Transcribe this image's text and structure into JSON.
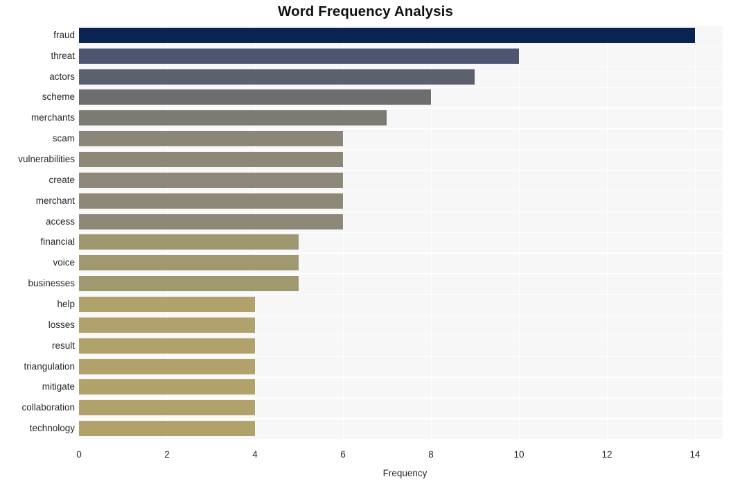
{
  "chart_data": {
    "type": "bar",
    "orientation": "horizontal",
    "title": "Word Frequency Analysis",
    "xlabel": "Frequency",
    "ylabel": "",
    "categories": [
      "fraud",
      "threat",
      "actors",
      "scheme",
      "merchants",
      "scam",
      "vulnerabilities",
      "create",
      "merchant",
      "access",
      "financial",
      "voice",
      "businesses",
      "help",
      "losses",
      "result",
      "triangulation",
      "mitigate",
      "collaboration",
      "technology"
    ],
    "values": [
      14,
      10,
      9,
      8,
      7,
      6,
      6,
      6,
      6,
      6,
      5,
      5,
      5,
      4,
      4,
      4,
      4,
      4,
      4,
      4
    ],
    "bar_colors": [
      "#0a2350",
      "#4d5570",
      "#5c616e",
      "#6b6d6e",
      "#7c7b73",
      "#8a8678",
      "#8c8878",
      "#8d8878",
      "#8d8878",
      "#8d8878",
      "#9f9770",
      "#a0986f",
      "#a0986f",
      "#b0a26a",
      "#b0a26a",
      "#b0a26a",
      "#b0a26a",
      "#b0a26a",
      "#b0a26a",
      "#b0a26a"
    ],
    "xticks": [
      0,
      2,
      4,
      6,
      8,
      10,
      12,
      14
    ],
    "xlim": [
      0,
      14.63
    ],
    "grid": true,
    "legend": false,
    "plot_background": "#f7f7f7",
    "gridline_color": "#ffffff",
    "figure_background": "#ffffff",
    "text_color": "#262626"
  }
}
